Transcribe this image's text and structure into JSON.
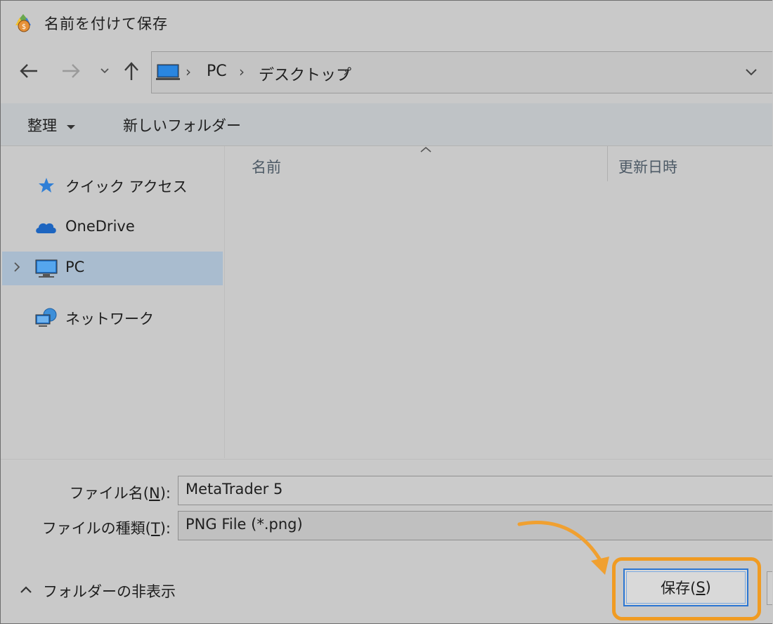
{
  "window": {
    "title": "名前を付けて保存"
  },
  "nav": {
    "back": "back-arrow",
    "forward": "forward-arrow",
    "recent": "recent-dropdown",
    "up": "up-arrow"
  },
  "address": {
    "crumbs": [
      "PC",
      "デスクトップ"
    ]
  },
  "toolbar": {
    "organize": "整理",
    "new_folder": "新しいフォルダー"
  },
  "sidebar": {
    "items": [
      {
        "label": "クイック アクセス",
        "icon": "star-icon"
      },
      {
        "label": "OneDrive",
        "icon": "cloud-icon"
      },
      {
        "label": "PC",
        "icon": "monitor-icon",
        "selected": true
      },
      {
        "label": "ネットワーク",
        "icon": "network-icon"
      }
    ]
  },
  "filelist": {
    "columns": [
      "名前",
      "更新日時"
    ]
  },
  "form": {
    "filename_label_pre": "ファイル名(",
    "filename_mnemonic": "N",
    "filename_label_post": "):",
    "filename_value": "MetaTrader 5",
    "filetype_label_pre": "ファイルの種類(",
    "filetype_mnemonic": "T",
    "filetype_label_post": "):",
    "filetype_value": "PNG File (*.png)"
  },
  "footer": {
    "hide_folders": "フォルダーの非表示",
    "save_pre": "保存(",
    "save_mnemonic": "S",
    "save_post": ")"
  },
  "colors": {
    "highlight": "#f09b22",
    "selected_row": "#a9bccf",
    "button_focus": "#2b76d2"
  }
}
